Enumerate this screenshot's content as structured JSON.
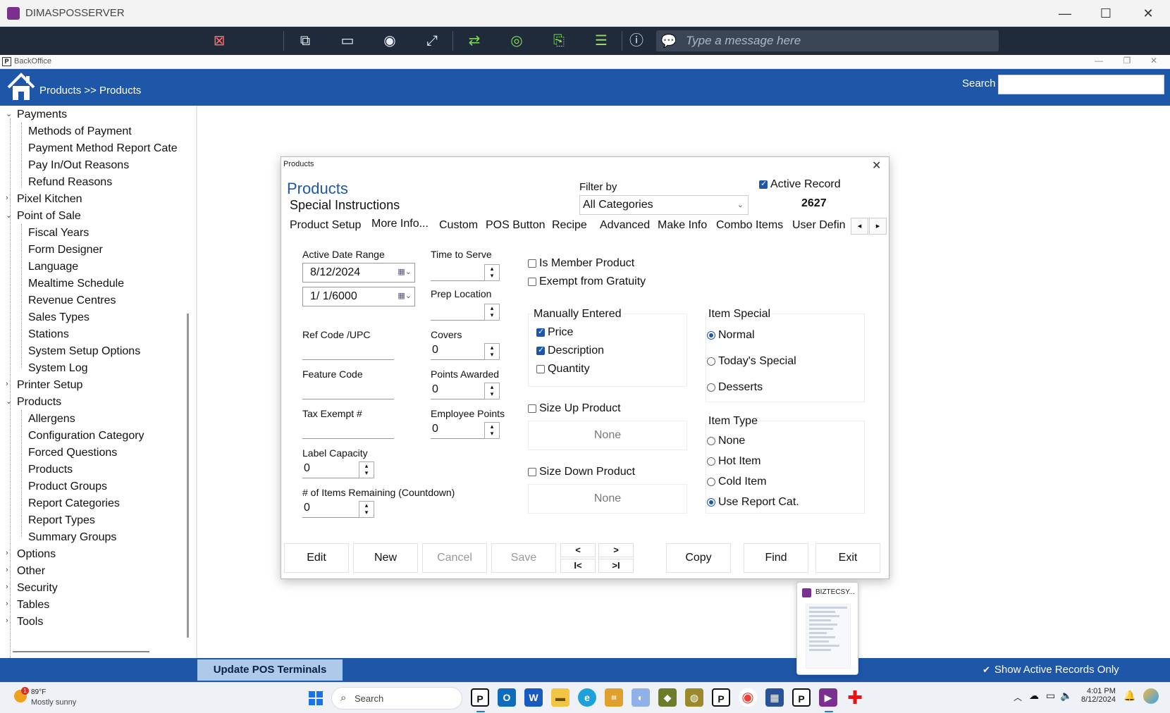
{
  "window": {
    "title": "DIMASPOSSERVER",
    "minimize": "—",
    "maximize": "☐",
    "close": "✕"
  },
  "remote_toolbar": {
    "message_placeholder": "Type a message here"
  },
  "backoffice_bar": {
    "icon": "P",
    "title": "BackOffice",
    "min": "—",
    "restore": "❐",
    "close": "✕"
  },
  "header": {
    "breadcrumb": "Products >> Products",
    "search_label": "Search",
    "search_value": ""
  },
  "tree": {
    "payments": "Payments",
    "payments_children": [
      "Methods of Payment",
      "Payment Method Report Cate",
      "Pay In/Out Reasons",
      "Refund Reasons"
    ],
    "pixel_kitchen": "Pixel Kitchen",
    "point_of_sale": "Point of Sale",
    "pos_children": [
      "Fiscal Years",
      "Form Designer",
      "Language",
      "Mealtime Schedule",
      "Revenue Centres",
      "Sales Types",
      "Stations",
      "System Setup Options",
      "System Log"
    ],
    "printer_setup": "Printer Setup",
    "products": "Products",
    "products_children": [
      "Allergens",
      "Configuration Category",
      "Forced Questions",
      "Products",
      "Product Groups",
      "Report Categories",
      "Report Types",
      "Summary Groups"
    ],
    "options": "Options",
    "other": "Other",
    "security": "Security",
    "tables": "Tables",
    "tools": "Tools"
  },
  "dialog": {
    "window_title": "Products",
    "close": "✕",
    "heading": "Products",
    "subheading": "Special Instructions",
    "filter_label": "Filter by",
    "filter_value": "All Categories",
    "active_record_label": "Active Record",
    "active_record_checked": true,
    "record_number": "2627",
    "tabs": [
      "Product Setup",
      "More Info...",
      "Custom",
      "POS Button",
      "Recipe",
      "Advanced",
      "Make Info",
      "Combo Items",
      "User Defin"
    ],
    "tab_prev": "◂",
    "tab_next": "▸",
    "fields": {
      "active_date_range_label": "Active Date Range",
      "date_from": "8/12/2024",
      "date_to": "1/  1/6000",
      "ref_code_label": "Ref Code /UPC",
      "ref_code_value": "",
      "feature_code_label": "Feature Code",
      "feature_code_value": "",
      "tax_exempt_label": "Tax Exempt #",
      "tax_exempt_value": "",
      "label_capacity_label": "Label Capacity",
      "label_capacity_value": "0",
      "items_remaining_label": "# of Items Remaining (Countdown)",
      "items_remaining_value": "0",
      "time_to_serve_label": "Time to Serve",
      "time_to_serve_value": "",
      "prep_location_label": "Prep Location",
      "prep_location_value": "",
      "covers_label": "Covers",
      "covers_value": "0",
      "points_awarded_label": "Points Awarded",
      "points_awarded_value": "0",
      "employee_points_label": "Employee Points",
      "employee_points_value": "0"
    },
    "checks": {
      "member_product": "Is Member Product",
      "exempt_gratuity": "Exempt from Gratuity",
      "manually_entered_title": "Manually Entered",
      "price": "Price",
      "description": "Description",
      "quantity": "Quantity",
      "size_up": "Size Up Product",
      "size_up_value": "None",
      "size_down": "Size Down Product",
      "size_down_value": "None"
    },
    "item_special": {
      "title": "Item Special",
      "options": [
        "Normal",
        "Today's Special",
        "Desserts"
      ],
      "selected": "Normal"
    },
    "item_type": {
      "title": "Item Type",
      "options": [
        "None",
        "Hot Item",
        "Cold Item",
        "Use Report Cat."
      ],
      "selected": "Use Report Cat."
    },
    "buttons": {
      "edit": "Edit",
      "new": "New",
      "cancel": "Cancel",
      "save": "Save",
      "prev": "<",
      "next": ">",
      "first": "I<",
      "last": ">I",
      "copy": "Copy",
      "find": "Find",
      "exit": "Exit"
    }
  },
  "status_bar": {
    "update_button": "Update POS Terminals",
    "show_active_label": "Show Active Records Only"
  },
  "thumbnail": {
    "title": "BIZTECSY..."
  },
  "taskbar": {
    "weather_temp": "89°F",
    "weather_cond": "Mostly sunny",
    "weather_badge": "1",
    "search_text": "Search",
    "time": "4:01 PM",
    "date": "8/12/2024"
  }
}
